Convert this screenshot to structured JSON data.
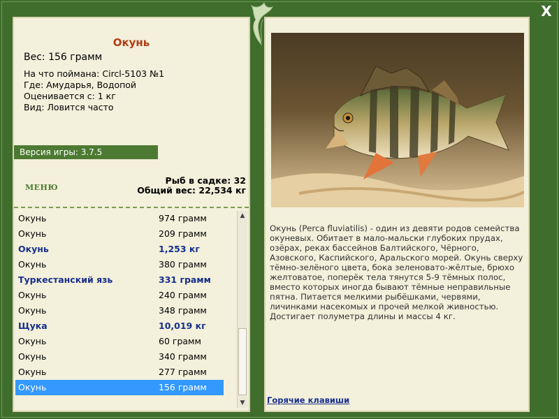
{
  "window": {
    "close_symbol": "X"
  },
  "fish": {
    "title": "Окунь",
    "weight": "Вес: 156 грамм",
    "caught_with": "На что поймана: Circl-5103 №1",
    "location": "Где: Амударья, Водопой",
    "rated_from": "Оценивается с: 1 кг",
    "species_note": "Вид: Ловится часто"
  },
  "version": "Версия игры: 3.7.5",
  "menu_label": "МЕНЮ",
  "stats": {
    "fish_in_keepnet": "Рыб в садке: 32",
    "total_weight": "Общий вес: 22,534 кг"
  },
  "catch_list": [
    {
      "name": "Окунь",
      "weight": "974 грамм"
    },
    {
      "name": "Окунь",
      "weight": "209 грамм"
    },
    {
      "name": "Окунь",
      "weight": "1,253 кг"
    },
    {
      "name": "Окунь",
      "weight": "380 грамм"
    },
    {
      "name": "Туркестанский язь",
      "weight": "331 грамм"
    },
    {
      "name": "Окунь",
      "weight": "240 грамм"
    },
    {
      "name": "Окунь",
      "weight": "348 грамм"
    },
    {
      "name": "Щука",
      "weight": "10,019 кг"
    },
    {
      "name": "Окунь",
      "weight": "60 грамм"
    },
    {
      "name": "Окунь",
      "weight": "340 грамм"
    },
    {
      "name": "Окунь",
      "weight": "277 грамм"
    },
    {
      "name": "Окунь",
      "weight": "156 грамм"
    }
  ],
  "description": "Окунь (Perca fluviatilis) - один из девяти родов семейства окуневых. Обитает в мало-мальски глубоких прудах, озёрах, реках бассейнов Балтийского, Чёрного, Азовского, Каспийского, Аральского морей. Окунь сверху тёмно-зелёного цвета, бока зеленовато-жёлтые, брюхо желтоватое, поперёк тела тянутся 5-9 тёмных полос, вместо которых иногда бывают тёмные неправильные пятна. Питается мелкими рыбёшками, червями, личинками насекомых и прочей мелкой живностью. Достигает полуметра длины и массы 4 кг.",
  "hotkeys_label": "Горячие клавиши",
  "colors": {
    "frame_green": "#3f6d2c",
    "panel_bg": "#f3f0db",
    "title_red": "#b43b12",
    "highlight_blue": "#172f8d",
    "selection": "#3399ff"
  }
}
